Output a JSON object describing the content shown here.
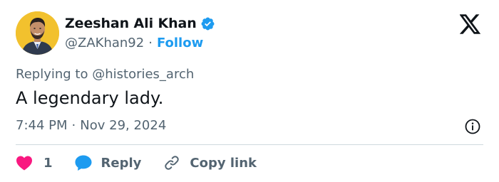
{
  "author": {
    "display_name": "Zeeshan Ali Khan",
    "handle": "@ZAKhan92",
    "separator": "·",
    "follow_label": "Follow",
    "verified": true,
    "verified_color": "#1d9bf0",
    "avatar_background": "#f2c12e"
  },
  "platform": {
    "logo_icon": "x-logo-icon"
  },
  "tweet": {
    "reply_prefix": "Replying to",
    "reply_mention": "@histories_arch",
    "text": "A legendary lady.",
    "time": "7:44 PM",
    "meta_separator": "·",
    "date": "Nov 29, 2024"
  },
  "actions": {
    "like_count": "1",
    "like_icon": "heart-icon",
    "like_color": "#f91880",
    "reply_label": "Reply",
    "reply_icon": "speech-bubble-icon",
    "reply_color": "#1d9bf0",
    "copy_label": "Copy link",
    "copy_icon": "link-icon"
  },
  "colors": {
    "text_primary": "#0f1419",
    "text_secondary": "#536471",
    "accent": "#1d9bf0",
    "divider": "#cfd9de"
  }
}
